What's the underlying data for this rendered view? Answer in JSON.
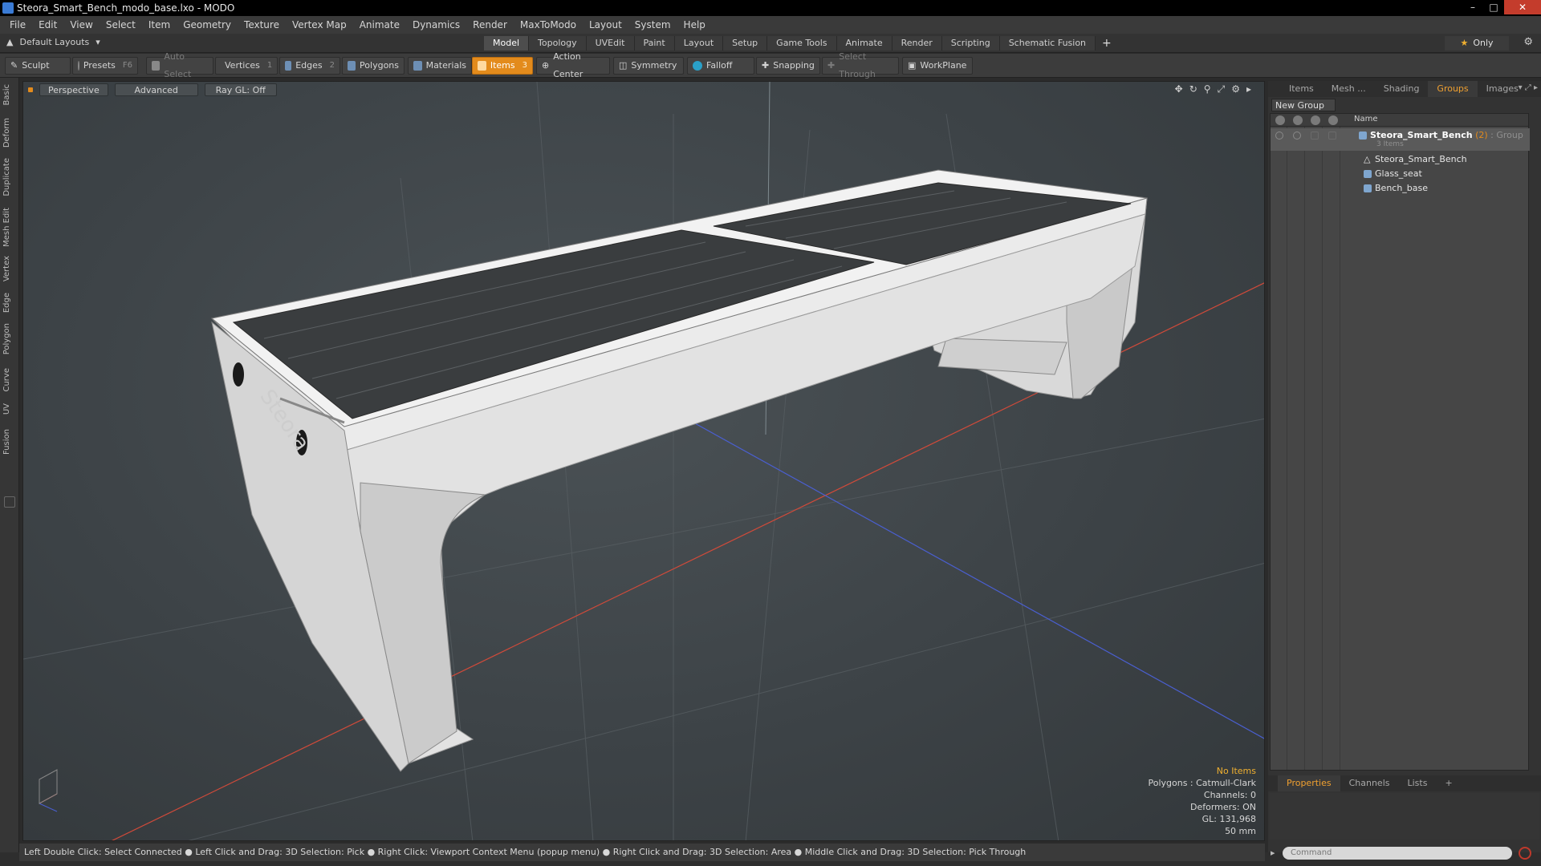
{
  "window": {
    "title": "Steora_Smart_Bench_modo_base.lxo - MODO"
  },
  "menu": [
    "File",
    "Edit",
    "View",
    "Select",
    "Item",
    "Geometry",
    "Texture",
    "Vertex Map",
    "Animate",
    "Dynamics",
    "Render",
    "MaxToModo",
    "Layout",
    "System",
    "Help"
  ],
  "layouts": {
    "label": "Default Layouts"
  },
  "mode_tabs": [
    "Model",
    "Topology",
    "UVEdit",
    "Paint",
    "Layout",
    "Setup",
    "Game Tools",
    "Animate",
    "Render",
    "Scripting",
    "Schematic Fusion"
  ],
  "mode_active": "Model",
  "only_label": "Only",
  "toolbar": {
    "sculpt": "Sculpt",
    "presets": "Presets",
    "presets_key": "F6",
    "auto_select": "Auto Select",
    "vertices": "Vertices",
    "vertices_count": "1",
    "edges": "Edges",
    "edges_count": "2",
    "polygons": "Polygons",
    "materials": "Materials",
    "items": "Items",
    "items_count": "3",
    "action_center": "Action Center",
    "symmetry": "Symmetry",
    "falloff": "Falloff",
    "snapping": "Snapping",
    "select_through": "Select Through",
    "workplane": "WorkPlane"
  },
  "left_tabs": [
    "Basic",
    "Deform",
    "Duplicate",
    "Mesh Edit",
    "Vertex",
    "Edge",
    "Polygon",
    "Curve",
    "UV",
    "Fusion"
  ],
  "viewport": {
    "perspective": "Perspective",
    "advanced": "Advanced",
    "raygl": "Ray GL: Off",
    "info": {
      "no_items": "No Items",
      "polygons": "Polygons : Catmull-Clark",
      "channels": "Channels: 0",
      "deformers": "Deformers: ON",
      "gl": "GL: 131,968",
      "scale": "50 mm"
    }
  },
  "right_panel": {
    "tabs": [
      "Items",
      "Mesh ...",
      "Shading",
      "Groups",
      "Images"
    ],
    "active_tab": "Groups",
    "new_group": "New Group",
    "name_header": "Name",
    "group": {
      "name": "Steora_Smart_Bench",
      "count": "(2)",
      "type": ": Group",
      "items_label": "3 Items"
    },
    "children": [
      "Steora_Smart_Bench",
      "Glass_seat",
      "Bench_base"
    ],
    "bottom_tabs": [
      "Properties",
      "Channels",
      "Lists",
      "+"
    ]
  },
  "command": {
    "placeholder": "Command"
  },
  "status": "Left Double Click: Select Connected ● Left Click and Drag: 3D Selection: Pick ● Right Click: Viewport Context Menu (popup menu) ● Right Click and Drag: 3D Selection: Area ● Middle Click and Drag: 3D Selection: Pick Through",
  "colors": {
    "accent": "#e38b1c",
    "x_axis": "#d04a3a",
    "z_axis": "#4a5fd0",
    "background": "#3d4347"
  }
}
